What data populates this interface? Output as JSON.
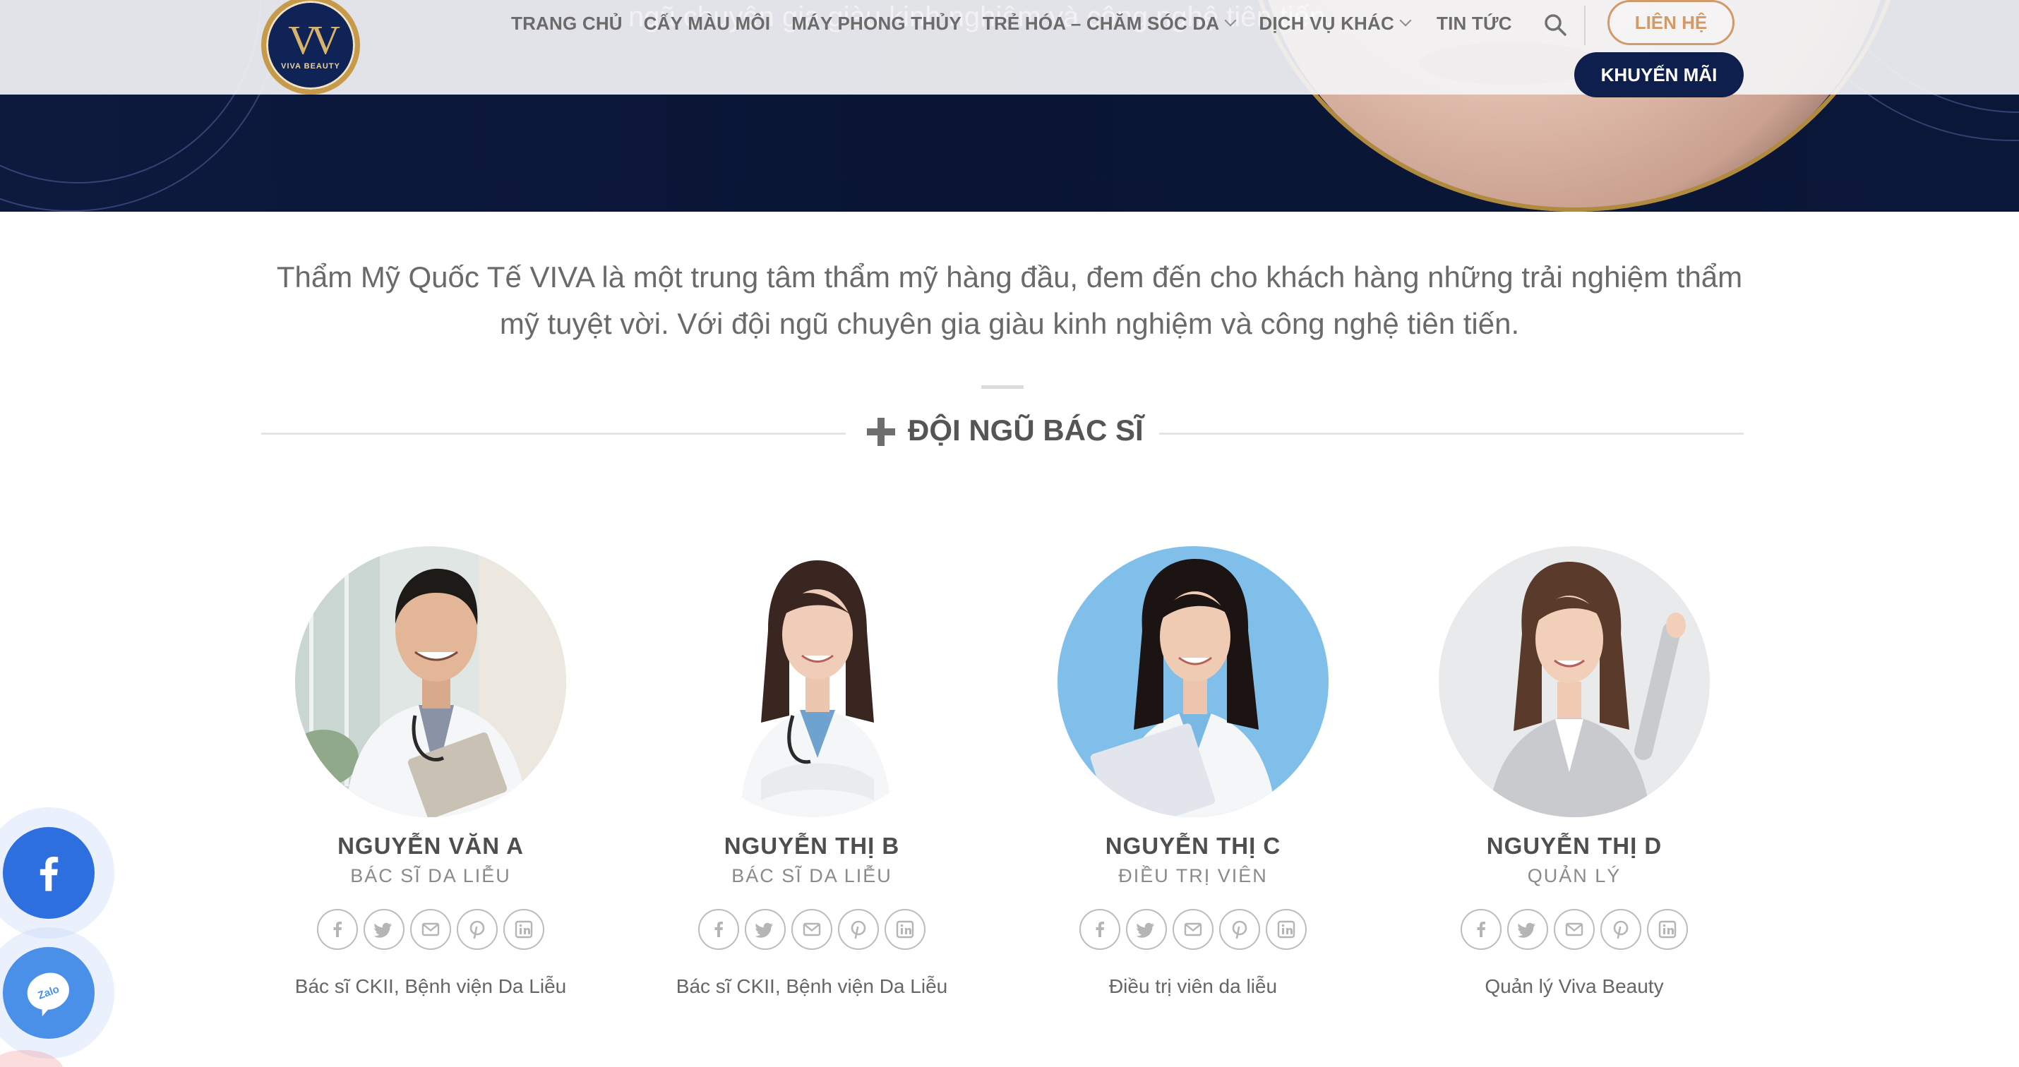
{
  "header": {
    "nav": [
      {
        "label": "TRANG CHỦ",
        "dropdown": false
      },
      {
        "label": "CẤY MÀU MÔI",
        "dropdown": false
      },
      {
        "label": "MÁY PHONG THỦY",
        "dropdown": false
      },
      {
        "label": "TRẺ HÓA – CHĂM SÓC DA",
        "dropdown": true
      },
      {
        "label": "DỊCH VỤ KHÁC",
        "dropdown": true
      },
      {
        "label": "TIN TỨC",
        "dropdown": false
      }
    ],
    "contact_label": "LIÊN HỆ",
    "promo_label": "KHUYẾN MÃI",
    "logo_monogram": "VV",
    "logo_text": "VIVA BEAUTY",
    "ghost_text": "ngũ chuyên gia giàu kinh nghiệm và công nghệ tiên tiến."
  },
  "intro": {
    "text": "Thẩm Mỹ Quốc Tế VIVA là một trung tâm thẩm mỹ hàng đầu, đem đến cho khách hàng những trải nghiệm thẩm mỹ tuyệt vời. Với đội ngũ chuyên gia giàu kinh nghiệm và công nghệ tiên tiến."
  },
  "section": {
    "title": "ĐỘI NGŨ BÁC SĨ"
  },
  "team": [
    {
      "name": "NGUYỄN VĂN A",
      "role": "BÁC SĨ DA LIỄU",
      "desc": "Bác sĩ CKII, Bệnh viện Da Liễu"
    },
    {
      "name": "NGUYỄN THỊ B",
      "role": "BÁC SĨ DA LIỄU",
      "desc": "Bác sĩ CKII, Bệnh viện Da Liễu"
    },
    {
      "name": "NGUYỄN THỊ C",
      "role": "ĐIỀU TRỊ VIÊN",
      "desc": "Điều trị viên da liễu"
    },
    {
      "name": "NGUYỄN THỊ D",
      "role": "QUẢN LÝ",
      "desc": "Quản lý Viva Beauty"
    }
  ],
  "social_icons": [
    "facebook-icon",
    "twitter-icon",
    "email-icon",
    "pinterest-icon",
    "linkedin-icon"
  ],
  "floating": {
    "facebook": "facebook-icon",
    "zalo_label": "Zalo"
  },
  "colors": {
    "brand_navy": "#0f1f4d",
    "accent_gold": "#c79a4a",
    "contact_copper": "#d19a6b",
    "text_gray": "#6a6a6a"
  }
}
